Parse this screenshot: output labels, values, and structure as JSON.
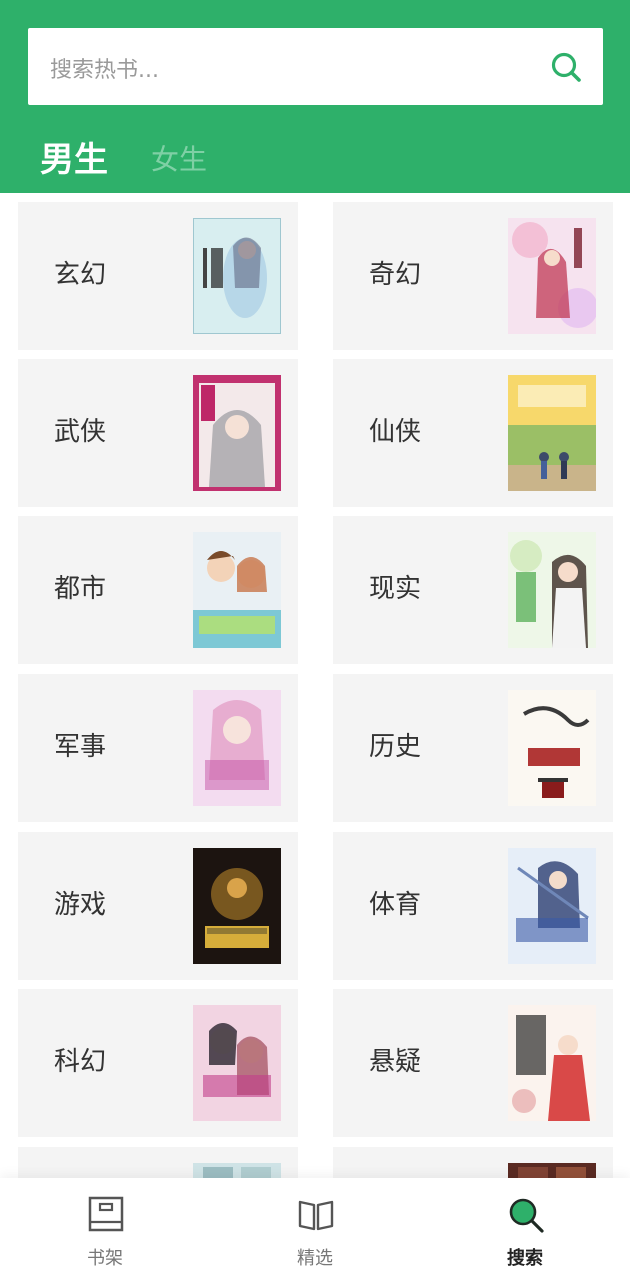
{
  "search": {
    "placeholder": "搜索热书..."
  },
  "tabs": [
    {
      "label": "男生",
      "active": true
    },
    {
      "label": "女生",
      "active": false
    }
  ],
  "categories": [
    {
      "label": "玄幻"
    },
    {
      "label": "奇幻"
    },
    {
      "label": "武侠"
    },
    {
      "label": "仙侠"
    },
    {
      "label": "都市"
    },
    {
      "label": "现实"
    },
    {
      "label": "军事"
    },
    {
      "label": "历史"
    },
    {
      "label": "游戏"
    },
    {
      "label": "体育"
    },
    {
      "label": "科幻"
    },
    {
      "label": "悬疑"
    },
    {
      "label": ""
    },
    {
      "label": ""
    }
  ],
  "bottom_nav": [
    {
      "label": "书架",
      "icon": "bookshelf-icon",
      "active": false
    },
    {
      "label": "精选",
      "icon": "open-book-icon",
      "active": false
    },
    {
      "label": "搜索",
      "icon": "search-icon",
      "active": true
    }
  ],
  "colors": {
    "brand": "#2eb06a",
    "card_bg": "#f4f4f4",
    "tab_inactive": "#7fd0a5"
  }
}
